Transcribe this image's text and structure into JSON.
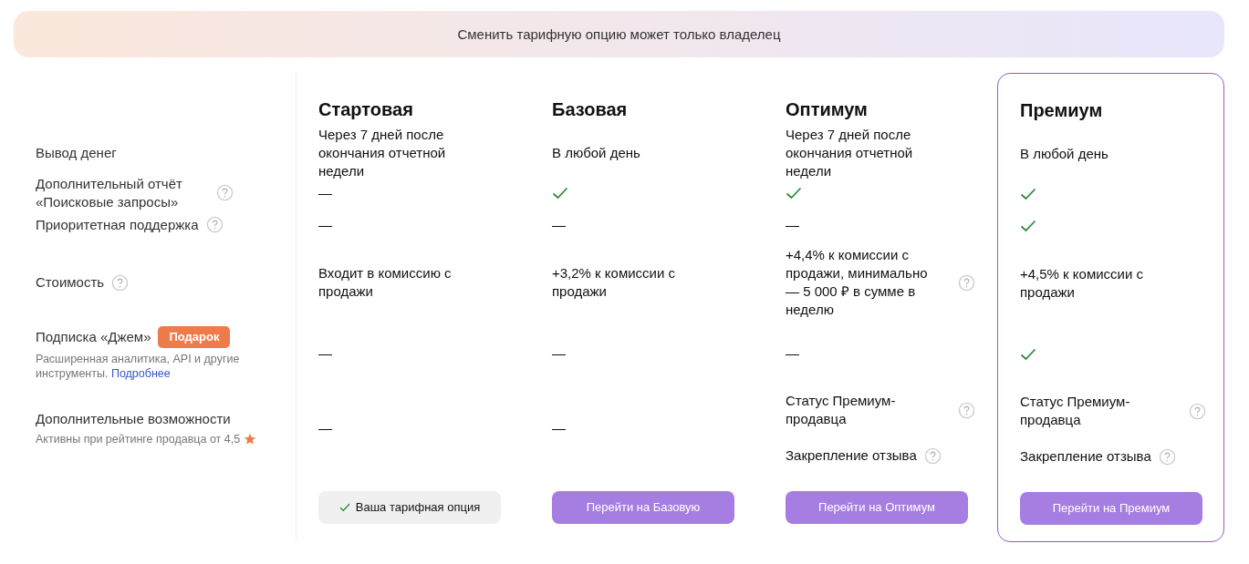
{
  "banner": {
    "text": "Сменить тарифную опцию может только владелец"
  },
  "features": [
    {
      "label": "Вывод денег",
      "help": false
    },
    {
      "label": "Дополнительный отчёт «Поисковые запросы»",
      "help": true
    },
    {
      "label": "Приоритетная поддержка",
      "help": true
    },
    {
      "label": "Стоимость",
      "help": true
    },
    {
      "label": "Подписка «Джем»",
      "help": false,
      "badge": "Подарок",
      "note": "Расширенная аналитика, API и другие инструменты.",
      "link": "Подробнее",
      "star": false
    },
    {
      "label": "Дополнительные возможности",
      "help": false,
      "note": "Активны при рейтинге продавца от 4,5",
      "star": true
    }
  ],
  "plans": [
    {
      "name": "Стартовая",
      "highlighted": false,
      "cells": [
        {
          "kind": "text",
          "text": "Через 7 дней после окончания отчетной недели",
          "help": false
        },
        {
          "kind": "dash",
          "text": "—"
        },
        {
          "kind": "dash",
          "text": "—"
        },
        {
          "kind": "text",
          "text": "Входит в комиссию с продажи",
          "help": false
        },
        {
          "kind": "dash",
          "text": "—"
        },
        {
          "kind": "dash",
          "text": "—"
        }
      ],
      "button": {
        "kind": "current",
        "label": "Ваша тарифная опция"
      }
    },
    {
      "name": "Базовая",
      "highlighted": false,
      "cells": [
        {
          "kind": "text",
          "text": "В любой день",
          "help": false
        },
        {
          "kind": "check"
        },
        {
          "kind": "dash",
          "text": "—"
        },
        {
          "kind": "text",
          "text": "+3,2% к комиссии с продажи",
          "help": false
        },
        {
          "kind": "dash",
          "text": "—"
        },
        {
          "kind": "dash",
          "text": "—"
        }
      ],
      "button": {
        "kind": "switch",
        "label": "Перейти на Базовую"
      }
    },
    {
      "name": "Оптимум",
      "highlighted": false,
      "cells": [
        {
          "kind": "text",
          "text": "Через 7 дней после окончания отчетной недели",
          "help": false
        },
        {
          "kind": "check"
        },
        {
          "kind": "dash",
          "text": "—"
        },
        {
          "kind": "text",
          "text": "+4,4% к комиссии с продажи, минимально — 5 000 ₽ в сумме в неделю",
          "help": true
        },
        {
          "kind": "dash",
          "text": "—"
        },
        {
          "kind": "list",
          "items": [
            {
              "text": "Статус Премиум-продавца",
              "help": true
            },
            {
              "text": "Закрепление отзыва",
              "help": true
            }
          ]
        }
      ],
      "button": {
        "kind": "switch",
        "label": "Перейти на Оптимум"
      }
    },
    {
      "name": "Премиум",
      "highlighted": true,
      "cells": [
        {
          "kind": "text",
          "text": "В любой день",
          "help": false
        },
        {
          "kind": "check"
        },
        {
          "kind": "check"
        },
        {
          "kind": "text",
          "text": "+4,5% к комиссии с продажи",
          "help": false
        },
        {
          "kind": "check"
        },
        {
          "kind": "list",
          "items": [
            {
              "text": "Статус Премиум-продавца",
              "help": true
            },
            {
              "text": "Закрепление отзыва",
              "help": true
            }
          ]
        }
      ],
      "button": {
        "kind": "switch",
        "label": "Перейти на Премиум"
      }
    }
  ]
}
